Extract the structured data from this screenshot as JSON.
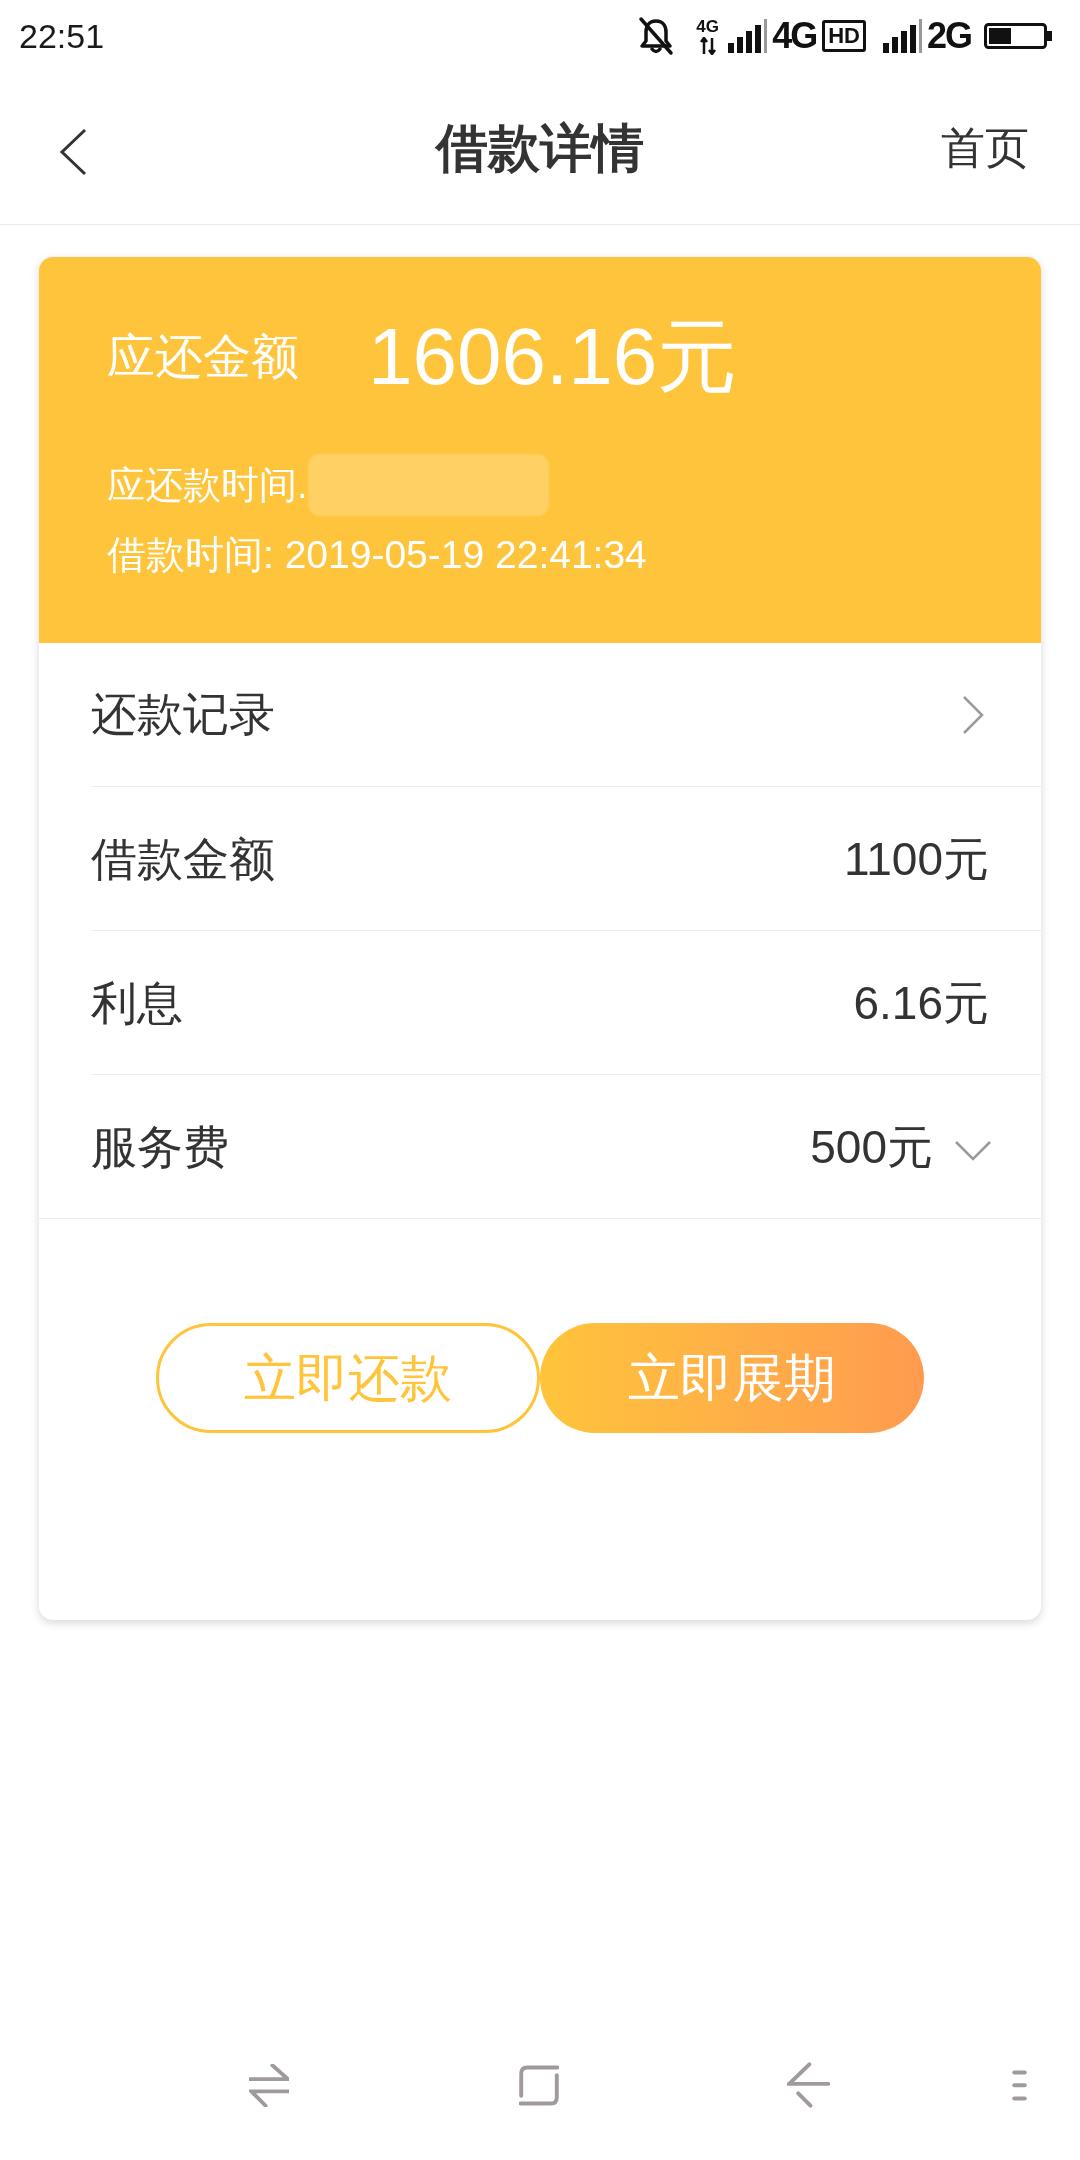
{
  "status_bar": {
    "time": "22:51",
    "data_type": "4G",
    "sim1_network": "4G",
    "hd_label": "HD",
    "sim2_network": "2G"
  },
  "header": {
    "title": "借款详情",
    "home_link": "首页"
  },
  "summary": {
    "amount_label": "应还金额",
    "amount": "1606.16元",
    "due_time_label": "应还款时间.",
    "due_time_redacted": true,
    "loan_time": "借款时间: 2019-05-19 22:41:34"
  },
  "rows": [
    {
      "kind": "link",
      "label": "还款记录"
    },
    {
      "kind": "value",
      "label": "借款金额",
      "value": "1100元"
    },
    {
      "kind": "value",
      "label": "利息",
      "value": "6.16元"
    },
    {
      "kind": "expandable",
      "label": "服务费",
      "value": "500元",
      "expanded": false
    }
  ],
  "buttons": [
    {
      "kind": "outline",
      "label": "立即还款"
    },
    {
      "kind": "filled",
      "label": "立即展期"
    }
  ]
}
